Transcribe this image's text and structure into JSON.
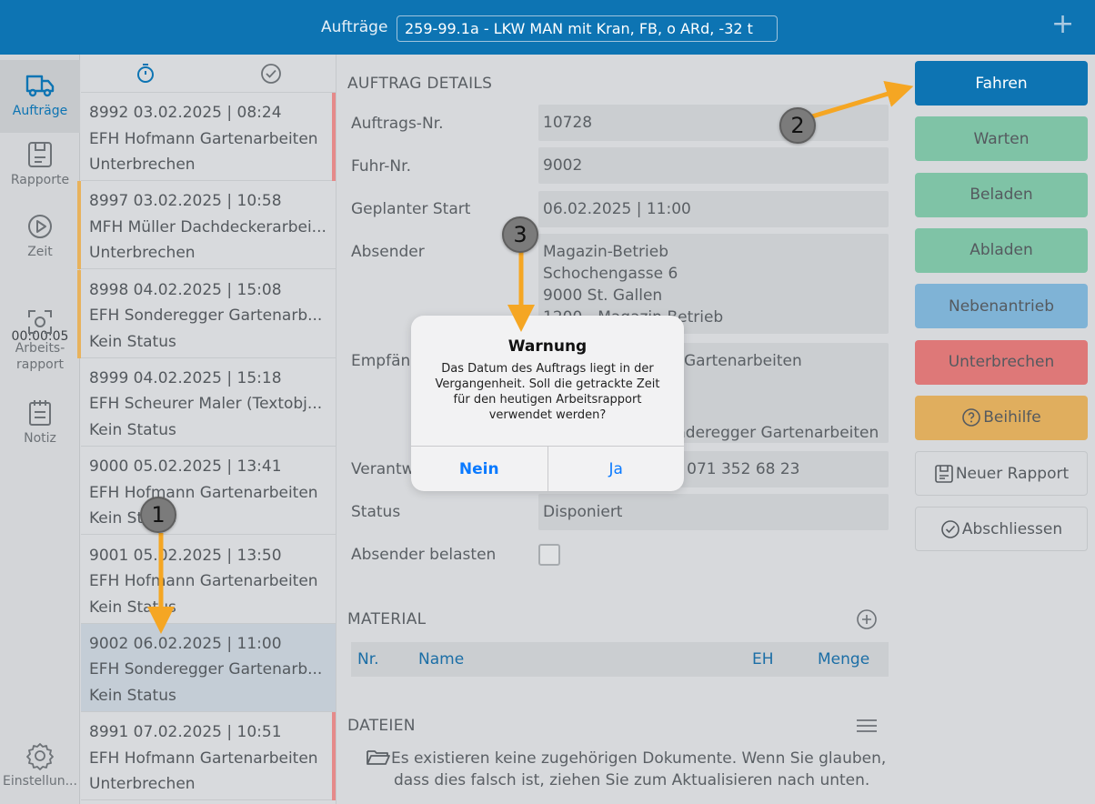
{
  "header": {
    "label": "Aufträge",
    "selected_vehicle": "259-99.1a - LKW MAN mit Kran, FB, o ARd, -32 t",
    "add_icon": "plus-icon"
  },
  "nav": {
    "items": [
      {
        "label": "Aufträge",
        "icon": "truck-icon",
        "active": true
      },
      {
        "label": "Rapporte",
        "icon": "clipboard-icon"
      },
      {
        "label": "Zeit",
        "icon": "play-icon"
      },
      {
        "label": "Arbeits-rapport",
        "icon": "focus-icon"
      },
      {
        "label": "Notiz",
        "icon": "notepad-icon"
      },
      {
        "label": "Einstellun...",
        "icon": "gear-icon"
      }
    ],
    "timer": "00:00:05"
  },
  "order_list": {
    "header_icons": [
      "stopwatch-icon",
      "check-circle-icon"
    ],
    "orders": [
      {
        "line1": "8992  03.02.2025 | 08:24",
        "line2": "EFH Hofmann Gartenarbeiten",
        "line3": "Unterbrechen",
        "bar_color": "#e58a8a",
        "bar_side": "right"
      },
      {
        "line1": "8997  03.02.2025 | 10:58",
        "line2": "MFH Müller Dachdeckerarbei...",
        "line3": "Unterbrechen",
        "bar_color": "#e8b25c",
        "bar_side": "left"
      },
      {
        "line1": "8998  04.02.2025 | 15:08",
        "line2": "EFH Sonderegger Gartenarb...",
        "line3": "Kein Status",
        "bar_color": "#e8b25c",
        "bar_side": "left"
      },
      {
        "line1": "8999  04.02.2025 | 15:18",
        "line2": "EFH Scheurer Maler (Textobj...",
        "line3": "Kein Status"
      },
      {
        "line1": "9000  05.02.2025 | 13:41",
        "line2": "EFH Hofmann Gartenarbeiten",
        "line3": "Kein Status"
      },
      {
        "line1": "9001  05.02.2025 | 13:50",
        "line2": "EFH Hofmann Gartenarbeiten",
        "line3": "Kein Status"
      },
      {
        "line1": "9002  06.02.2025 | 11:00",
        "line2": "EFH Sonderegger Gartenarb...",
        "line3": "Kein Status",
        "selected": true
      },
      {
        "line1": "8991  07.02.2025 | 10:51",
        "line2": "EFH Hofmann Gartenarbeiten",
        "line3": "Unterbrechen",
        "bar_color": "#e58a8a",
        "bar_side": "right"
      }
    ]
  },
  "details": {
    "section_title": "AUFTRAG DETAILS",
    "auftrags_nr_label": "Auftrags-Nr.",
    "auftrags_nr": "10728",
    "fuhr_nr_label": "Fuhr-Nr.",
    "fuhr_nr": "9002",
    "start_label": "Geplanter Start",
    "start": "06.02.2025 | 11:00",
    "absender_label": "Absender",
    "absender_lines": [
      "Magazin-Betrieb",
      "Schochengasse 6",
      "9000 St. Gallen",
      "1200 - Magazin-Betrieb"
    ],
    "empfaenger_label": "Empfän",
    "empfaenger_line1": "Gartenarbeiten",
    "empfaenger_line2": "nderegger Gartenarbeiten",
    "verantw_label": "Verantw",
    "verantw_value": "| 071 352 68 23",
    "status_label": "Status",
    "status": "Disponiert",
    "absender_belasten_label": "Absender belasten",
    "absender_belasten_checked": false
  },
  "material": {
    "title": "MATERIAL",
    "add_icon": "plus-circle-icon",
    "columns": [
      "Nr.",
      "Name",
      "EH",
      "Menge"
    ]
  },
  "files": {
    "title": "DATEIEN",
    "menu_icon": "menu-icon",
    "empty_line1": "Es existieren keine zugehörigen Dokumente. Wenn Sie glauben,",
    "empty_line2": "dass dies falsch ist, ziehen Sie zum Aktualisieren nach unten."
  },
  "actions": [
    {
      "label": "Fahren",
      "bg": "#0d74b3",
      "fg": "#ffffff"
    },
    {
      "label": "Warten",
      "bg": "#7fc3a6",
      "fg": "#555a5f"
    },
    {
      "label": "Beladen",
      "bg": "#7fc3a6",
      "fg": "#555a5f"
    },
    {
      "label": "Abladen",
      "bg": "#7fc3a6",
      "fg": "#555a5f"
    },
    {
      "label": "Nebenantrieb",
      "bg": "#7fb3d6",
      "fg": "#555a5f"
    },
    {
      "label": "Unterbrechen",
      "bg": "#de7878",
      "fg": "#555a5f"
    },
    {
      "label": "Beihilfe",
      "bg": "#e0ae5e",
      "fg": "#555a5f",
      "icon": "help-circle-icon"
    },
    {
      "label": "Neuer Rapport",
      "outline": true,
      "icon": "clipboard-icon"
    },
    {
      "label": "Abschliessen",
      "outline": true,
      "icon": "check-circle-icon"
    }
  ],
  "dialog": {
    "title": "Warnung",
    "message": "Das Datum des Auftrags liegt in der Vergangenheit. Soll die getrackte Zeit für den heutigen Arbeitsrapport verwendet werden?",
    "no": "Nein",
    "yes": "Ja"
  },
  "annotations": {
    "markers": [
      "1",
      "2",
      "3"
    ],
    "arrow_color": "#f5a623"
  }
}
